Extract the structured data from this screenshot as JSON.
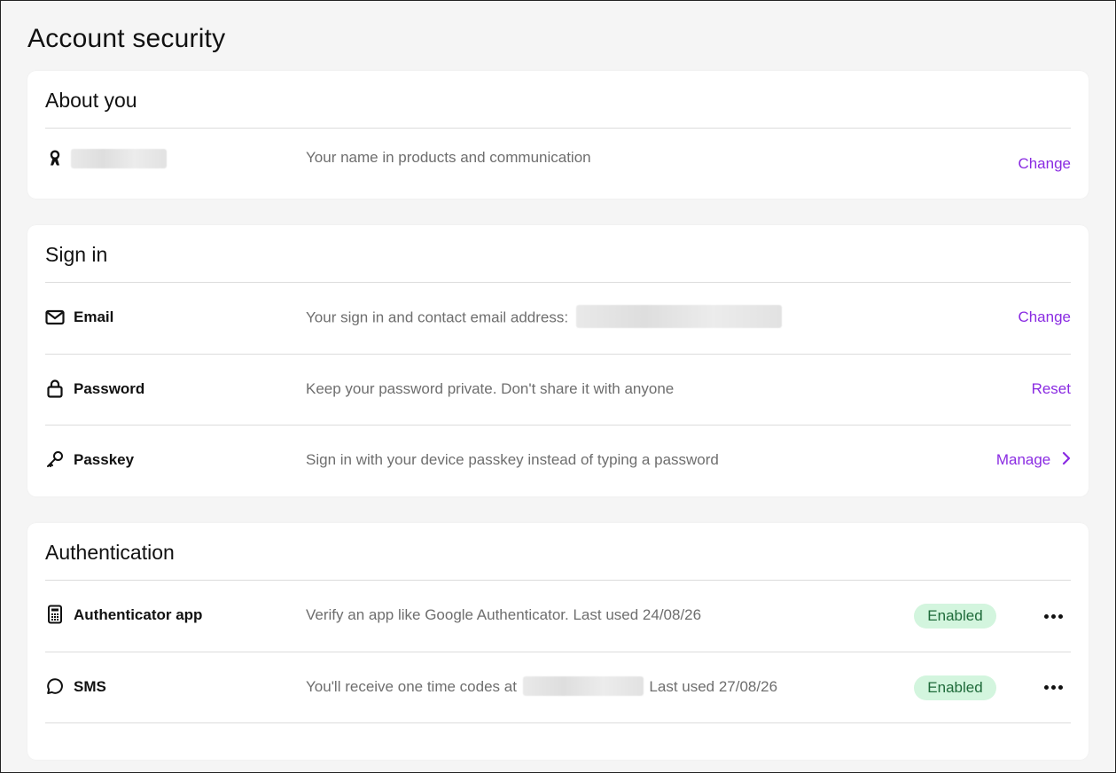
{
  "page": {
    "title": "Account security"
  },
  "about": {
    "title": "About you",
    "name_desc": "Your name in products and communication",
    "name_action": "Change"
  },
  "signin": {
    "title": "Sign in",
    "rows": [
      {
        "label": "Email",
        "desc": "Your sign in and contact email address:",
        "action": "Change",
        "icon": "mail-icon"
      },
      {
        "label": "Password",
        "desc": "Keep your password private. Don't share it with anyone",
        "action": "Reset",
        "icon": "lock-icon"
      },
      {
        "label": "Passkey",
        "desc": "Sign in with your device passkey instead of typing a password",
        "action": "Manage",
        "icon": "key-icon"
      }
    ]
  },
  "auth": {
    "title": "Authentication",
    "rows": [
      {
        "label": "Authenticator app",
        "desc": "Verify an app like Google Authenticator. Last used 24/08/26",
        "status": "Enabled",
        "icon": "calculator-icon"
      },
      {
        "label": "SMS",
        "desc_prefix": "You'll receive one time codes at",
        "desc_suffix": "Last used 27/08/26",
        "status": "Enabled",
        "icon": "chat-bubble-icon"
      }
    ]
  },
  "colors": {
    "accent": "#8a2be2",
    "badge_bg": "#d3f5de",
    "badge_text": "#1f6b3a",
    "desc_text": "#6e6e6e",
    "background": "#f5f5f5"
  }
}
